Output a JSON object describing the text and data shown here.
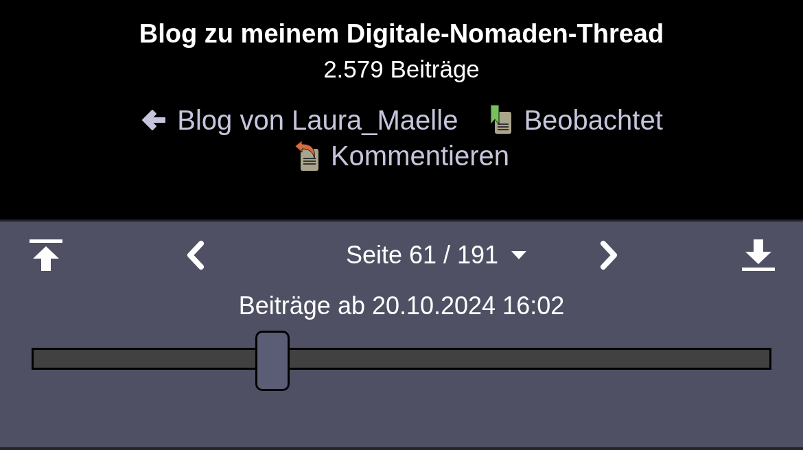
{
  "title": "Blog zu meinem Digitale-Nomaden-Thread",
  "post_count": "2.579 Beiträge",
  "links": [
    {
      "kind": "back",
      "label": "Blog von Laura_Maelle"
    },
    {
      "kind": "watched",
      "label": "Beobachtet"
    },
    {
      "kind": "comment",
      "label": "Kommentieren"
    }
  ],
  "pager": {
    "page_label": "Seite 61 / 191",
    "date_label": "Beiträge ab 20.10.2024 16:02",
    "level": 0.325
  }
}
